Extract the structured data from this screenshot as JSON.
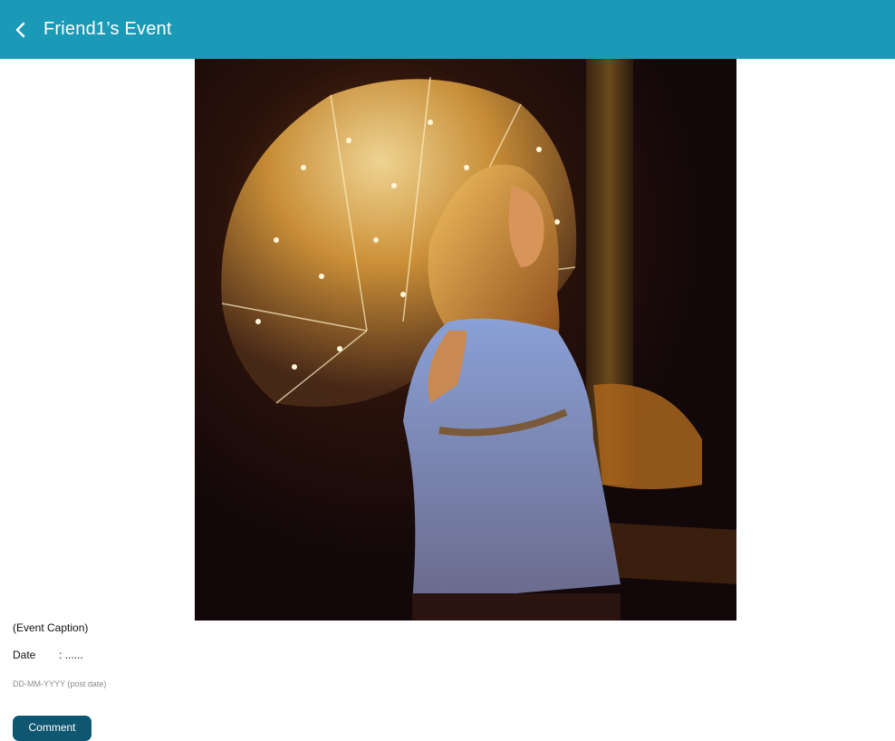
{
  "header": {
    "title": "Friend1’s Event",
    "back_icon": "chevron-left-icon",
    "background_color": "#1a9ab7"
  },
  "event": {
    "caption": "(Event Caption)",
    "date_label": "Date",
    "date_value": ": ......",
    "date_hint": "DD-MM-YYYY (post date)"
  },
  "actions": {
    "comment_label": "Comment",
    "comment_color": "#0f5670"
  }
}
